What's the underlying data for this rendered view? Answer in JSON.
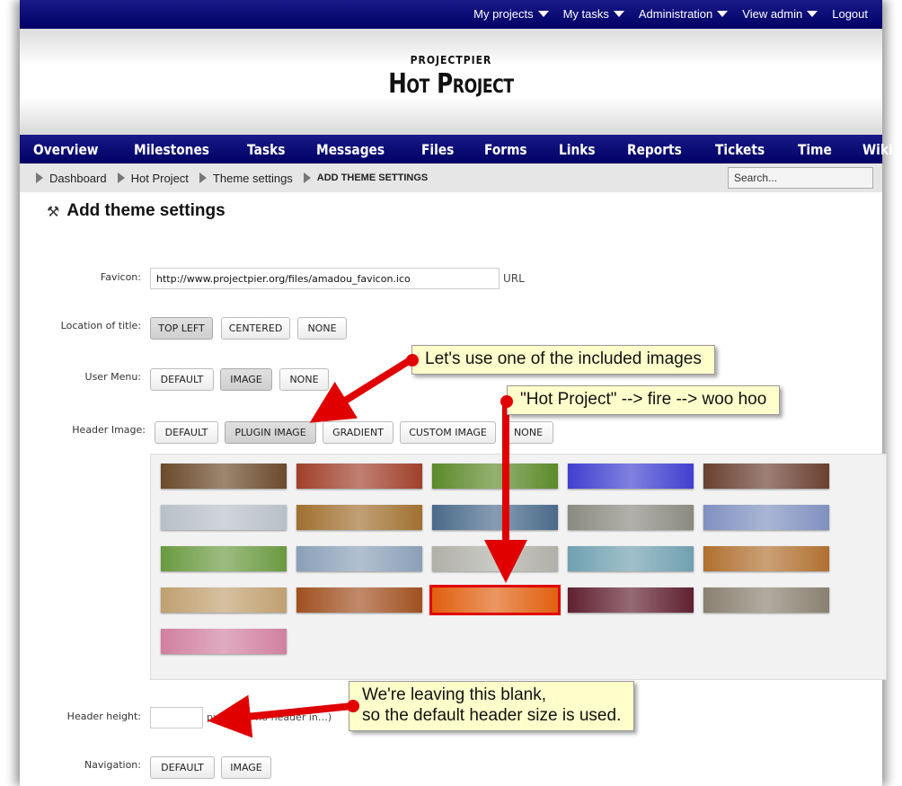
{
  "top_menu": {
    "items": [
      {
        "label": "My projects",
        "dropdown": true
      },
      {
        "label": "My tasks",
        "dropdown": true
      },
      {
        "label": "Administration",
        "dropdown": true
      },
      {
        "label": "View admin",
        "dropdown": true
      },
      {
        "label": "Logout",
        "dropdown": false
      }
    ]
  },
  "header": {
    "app_name": "PROJECTPIER",
    "project_name": "Hot Project"
  },
  "nav": {
    "tabs": [
      "Overview",
      "Milestones",
      "Tasks",
      "Messages",
      "Files",
      "Forms",
      "Links",
      "Reports",
      "Tickets",
      "Time",
      "Wiki"
    ]
  },
  "breadcrumb": {
    "items": [
      "Dashboard",
      "Hot Project",
      "Theme settings",
      "ADD THEME SETTINGS"
    ]
  },
  "search": {
    "placeholder": "Search..."
  },
  "page_title": "Add theme settings",
  "form": {
    "favicon": {
      "label": "Favicon:",
      "value": "http://www.projectpier.org/files/amadou_favicon.ico",
      "suffix": "URL"
    },
    "title_location": {
      "label": "Location of title:",
      "options": [
        "TOP LEFT",
        "CENTERED",
        "NONE"
      ],
      "selected": "TOP LEFT"
    },
    "user_menu": {
      "label": "User Menu:",
      "options": [
        "DEFAULT",
        "IMAGE",
        "NONE"
      ],
      "selected": "IMAGE"
    },
    "header_image": {
      "label": "Header Image:",
      "options": [
        "DEFAULT",
        "PLUGIN IMAGE",
        "GRADIENT",
        "CUSTOM IMAGE",
        "NONE"
      ],
      "selected": "PLUGIN IMAGE"
    },
    "header_height": {
      "label": "Header height:",
      "value": "",
      "hint": "px (… for no header in…)"
    },
    "navigation": {
      "label": "Navigation:",
      "options": [
        "DEFAULT",
        "IMAGE"
      ]
    }
  },
  "image_grid": {
    "count": 21,
    "selected_index": 17,
    "colors": [
      "#6a4a2a",
      "#a0402a",
      "#5c8a2a",
      "#4040d0",
      "#6a4030",
      "#b8c0c8",
      "#a07030",
      "#4a6a8a",
      "#8a8a80",
      "#8090c0",
      "#6a9a40",
      "#8aa0b8",
      "#b0b0a8",
      "#70a0b0",
      "#b07030",
      "#c0a070",
      "#a05020",
      "#e06010",
      "#602030",
      "#8a8070",
      "#d080a0"
    ]
  },
  "callouts": {
    "c1": "Let's use one of the included images",
    "c2": "\"Hot Project\" --> fire --> woo hoo",
    "c3_line1": "We're leaving this blank,",
    "c3_line2": "so the default header size is used."
  },
  "accent_colors": {
    "nav_blue": "#000064",
    "arrow_red": "#e00000",
    "callout_yellow": "#ffffcc"
  }
}
